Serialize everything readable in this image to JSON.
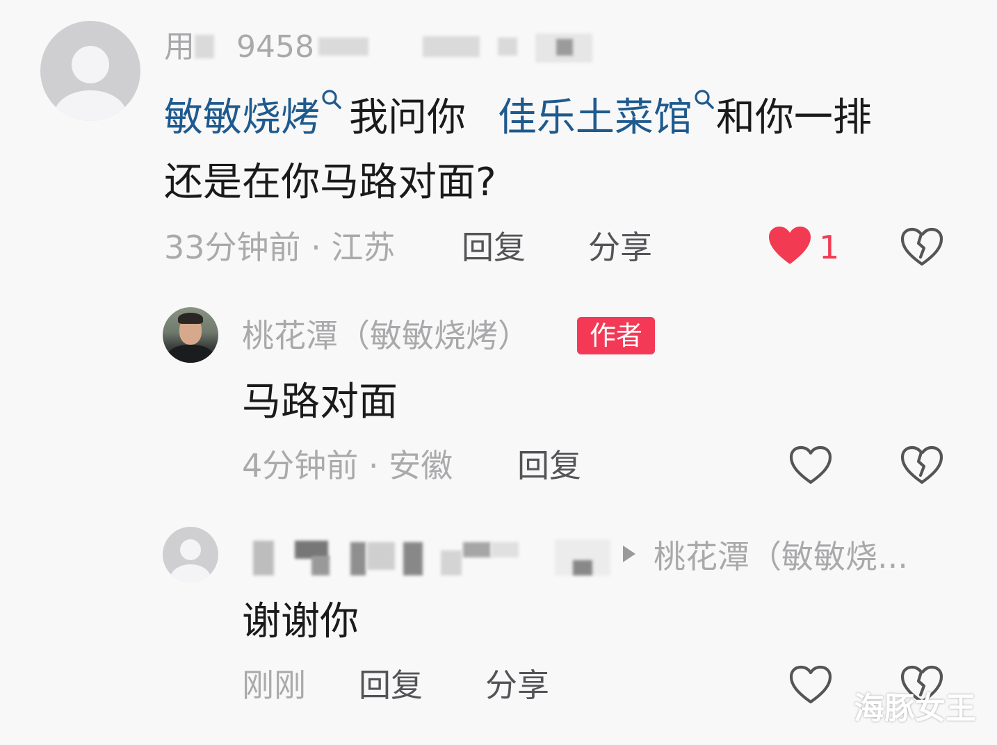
{
  "comments": [
    {
      "username_visible": "用",
      "username_partial": "9458",
      "text_parts": [
        {
          "text": "敏敏烧烤",
          "type": "link"
        },
        {
          "text": "我问你 ",
          "type": "plain"
        },
        {
          "text": "佳乐土菜馆",
          "type": "link"
        },
        {
          "text": "和你一排",
          "type": "plain"
        }
      ],
      "text_line2": "还是在你马路对面?",
      "time_location": "33分钟前 · 江苏",
      "reply_label": "回复",
      "share_label": "分享",
      "like_count": "1",
      "liked": true
    }
  ],
  "replies": [
    {
      "username": "桃花潭（敏敏烧烤）",
      "badge": "作者",
      "text": "马路对面",
      "time_location": "4分钟前 · 安徽",
      "reply_label": "回复"
    },
    {
      "reply_to": "桃花潭（敏敏烧...",
      "text": "谢谢你",
      "time_location": "刚刚",
      "reply_label": "回复",
      "share_label": "分享"
    }
  ],
  "watermark": "海豚女王",
  "colors": {
    "like_red": "#f23a52",
    "link_blue": "#1f5a8e",
    "badge_red": "#f33956",
    "meta_gray": "#aaaaac",
    "icon_gray": "#555558"
  },
  "icons": {
    "search": "search-icon",
    "like": "heart-icon",
    "dislike": "broken-heart-icon",
    "arrow": "triangle-right-icon"
  }
}
